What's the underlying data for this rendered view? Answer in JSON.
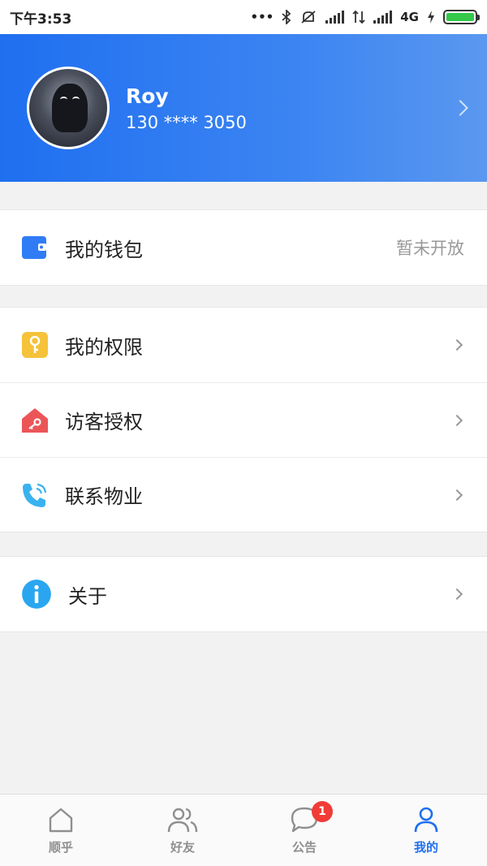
{
  "status_bar": {
    "time": "下午3:53",
    "network": "4G",
    "battery_color": "#34c94a"
  },
  "profile": {
    "name": "Roy",
    "phone": "130 **** 3050",
    "header_color": "#1f6ff0"
  },
  "sections": {
    "wallet": {
      "label": "我的钱包",
      "status": "暂未开放",
      "icon": "wallet-icon",
      "icon_color": "#2f7cf6"
    },
    "permissions": {
      "label": "我的权限",
      "icon": "key-icon",
      "icon_color": "#f5c23a"
    },
    "visitor": {
      "label": "访客授权",
      "icon": "house-key-icon",
      "icon_color": "#ec5558"
    },
    "contact": {
      "label": "联系物业",
      "icon": "phone-icon",
      "icon_color": "#3ab2ef"
    },
    "about": {
      "label": "关于",
      "icon": "info-icon",
      "icon_color": "#2aa6f0"
    }
  },
  "bottom_nav": {
    "items": [
      {
        "label": "顺乎",
        "icon": "home-icon"
      },
      {
        "label": "好友",
        "icon": "friends-icon"
      },
      {
        "label": "公告",
        "icon": "chat-bubble-icon",
        "badge": "1"
      },
      {
        "label": "我的",
        "icon": "person-icon",
        "active": true
      }
    ],
    "active_color": "#1f6ff0"
  }
}
